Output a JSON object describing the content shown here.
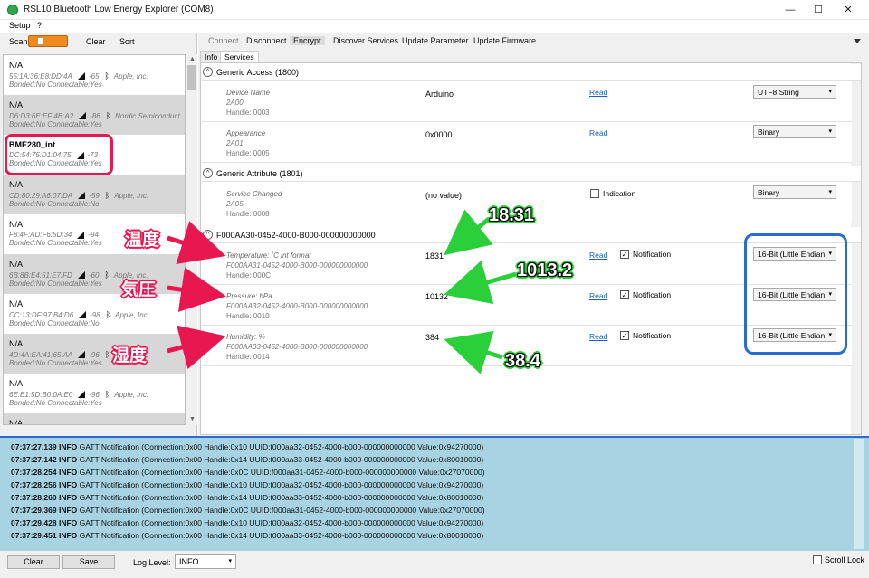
{
  "window": {
    "title": "RSL10 Bluetooth Low Energy Explorer (COM8)",
    "minimize": "—",
    "maximize": "☐",
    "close": "✕"
  },
  "menu": {
    "setup": "Setup",
    "help": "?"
  },
  "toolbar": {
    "scan": "Scan",
    "clear": "Clear",
    "sort": "Sort"
  },
  "devices": [
    {
      "name": "N/A",
      "addr": "55:1A:36:E8:DD:4A",
      "rssi": "-65",
      "vendor": "Apple, Inc.",
      "status": "Bonded:No Connectable:Yes",
      "bold": false,
      "gray": false
    },
    {
      "name": "N/A",
      "addr": "D6:D3:6E:EF:4B:A2",
      "rssi": "-86",
      "vendor": "Nordic Semiconduct",
      "status": "Bonded:No Connectable:Yes",
      "bold": false,
      "gray": true
    },
    {
      "name": "BME280_int",
      "addr": "DC:54:75:D1:04:75",
      "rssi": "-73",
      "vendor": "",
      "status": "Bonded:No Connectable:Yes",
      "bold": true,
      "gray": false
    },
    {
      "name": "N/A",
      "addr": "CD:80:29:A6:07:DA",
      "rssi": "-59",
      "vendor": "Apple, Inc.",
      "status": "Bonded:No Connectable:No",
      "bold": false,
      "gray": true
    },
    {
      "name": "N/A",
      "addr": "F8:4F:AD:F6:5D:34",
      "rssi": "-94",
      "vendor": "",
      "status": "Bonded:No Connectable:Yes",
      "bold": false,
      "gray": false
    },
    {
      "name": "N/A",
      "addr": "6B:8B:E4:51:E7:FD",
      "rssi": "-60",
      "vendor": "Apple, Inc.",
      "status": "Bonded:No Connectable:Yes",
      "bold": false,
      "gray": true
    },
    {
      "name": "N/A",
      "addr": "CC:13:DF:97:B4:D6",
      "rssi": "-98",
      "vendor": "Apple, Inc.",
      "status": "Bonded:No Connectable:No",
      "bold": false,
      "gray": false
    },
    {
      "name": "N/A",
      "addr": "4D:4A:EA:41:65:AA",
      "rssi": "-96",
      "vendor": "Apple, Inc.",
      "status": "Bonded:No Connectable:Yes",
      "bold": false,
      "gray": true
    },
    {
      "name": "N/A",
      "addr": "6E:E1:5D:B0:0A:E0",
      "rssi": "-96",
      "vendor": "Apple, Inc.",
      "status": "Bonded:No Connectable:Yes",
      "bold": false,
      "gray": false
    },
    {
      "name": "N/A",
      "addr": "",
      "rssi": "",
      "vendor": "",
      "status": "",
      "bold": false,
      "gray": true
    }
  ],
  "commands": {
    "connect": "Connect",
    "disconnect": "Disconnect",
    "encrypt": "Encrypt",
    "discover": "Discover Services",
    "update_param": "Update Parameter",
    "update_fw": "Update Firmware"
  },
  "inner_tabs": {
    "info": "Info",
    "services": "Services"
  },
  "services": {
    "generic_access": {
      "title": "Generic Access (1800)",
      "chars": [
        {
          "name": "Device Name",
          "uuid": "2A00",
          "handle": "Handle: 0003",
          "value": "Arduino",
          "read": "Read",
          "format": "UTF8 String"
        },
        {
          "name": "Appearance",
          "uuid": "2A01",
          "handle": "Handle: 0005",
          "value": "0x0000",
          "read": "Read",
          "format": "Binary"
        }
      ]
    },
    "generic_attribute": {
      "title": "Generic Attribute (1801)",
      "chars": [
        {
          "name": "Service Changed",
          "uuid": "2A05",
          "handle": "Handle: 0008",
          "value": "(no value)",
          "indication": "Indication",
          "format": "Binary"
        }
      ]
    },
    "custom": {
      "title": "F000AA30-0452-4000-B000-000000000000",
      "chars": [
        {
          "name": "Temperature: ˚C int format",
          "uuid": "F000AA31-0452-4000-B000-000000000000",
          "handle": "Handle: 000C",
          "value": "1831",
          "read": "Read",
          "notification": "Notification",
          "format": "16-Bit (Little Endian"
        },
        {
          "name": "Pressure: hPa",
          "uuid": "F000AA32-0452-4000-B000-000000000000",
          "handle": "Handle: 0010",
          "value": "10132",
          "read": "Read",
          "notification": "Notification",
          "format": "16-Bit (Little Endian"
        },
        {
          "name": "Humidity: %",
          "uuid": "F000AA33-0452-4000-B000-000000000000",
          "handle": "Handle: 0014",
          "value": "384",
          "read": "Read",
          "notification": "Notification",
          "format": "16-Bit (Little Endian"
        }
      ]
    }
  },
  "log": [
    {
      "time": "07:37:27.139",
      "level": "INFO",
      "msg": "GATT Notification (Connection:0x00 Handle:0x10 UUID:f000aa32-0452-4000-b000-000000000000 Value:0x94270000)"
    },
    {
      "time": "07:37:27.142",
      "level": "INFO",
      "msg": "GATT Notification (Connection:0x00 Handle:0x14 UUID:f000aa33-0452-4000-b000-000000000000 Value:0x80010000)"
    },
    {
      "time": "07:37:28.254",
      "level": "INFO",
      "msg": "GATT Notification (Connection:0x00 Handle:0x0C UUID:f000aa31-0452-4000-b000-000000000000 Value:0x27070000)"
    },
    {
      "time": "07:37:28.256",
      "level": "INFO",
      "msg": "GATT Notification (Connection:0x00 Handle:0x10 UUID:f000aa32-0452-4000-b000-000000000000 Value:0x94270000)"
    },
    {
      "time": "07:37:28.260",
      "level": "INFO",
      "msg": "GATT Notification (Connection:0x00 Handle:0x14 UUID:f000aa33-0452-4000-b000-000000000000 Value:0x80010000)"
    },
    {
      "time": "07:37:29.369",
      "level": "INFO",
      "msg": "GATT Notification (Connection:0x00 Handle:0x0C UUID:f000aa31-0452-4000-b000-000000000000 Value:0x27070000)"
    },
    {
      "time": "07:37:29.428",
      "level": "INFO",
      "msg": "GATT Notification (Connection:0x00 Handle:0x10 UUID:f000aa32-0452-4000-b000-000000000000 Value:0x94270000)"
    },
    {
      "time": "07:37:29.451",
      "level": "INFO",
      "msg": "GATT Notification (Connection:0x00 Handle:0x14 UUID:f000aa33-0452-4000-b000-000000000000 Value:0x80010000)"
    }
  ],
  "bottom": {
    "clear": "Clear",
    "save": "Save",
    "log_level_label": "Log Level:",
    "log_level": "INFO",
    "scroll_lock": "Scroll Lock"
  },
  "annotations": {
    "temp_jp": "温度",
    "pressure_jp": "気圧",
    "humidity_jp": "湿度",
    "temp_val": "18.31",
    "pressure_val": "1013.2",
    "humidity_val": "38.4"
  },
  "colors": {
    "accent_red": "#e8174f",
    "accent_blue": "#2a6bd1",
    "accent_green": "#2bcf3a",
    "log_bg": "#a7d3e3",
    "scan_orange": "#f08a1c"
  }
}
